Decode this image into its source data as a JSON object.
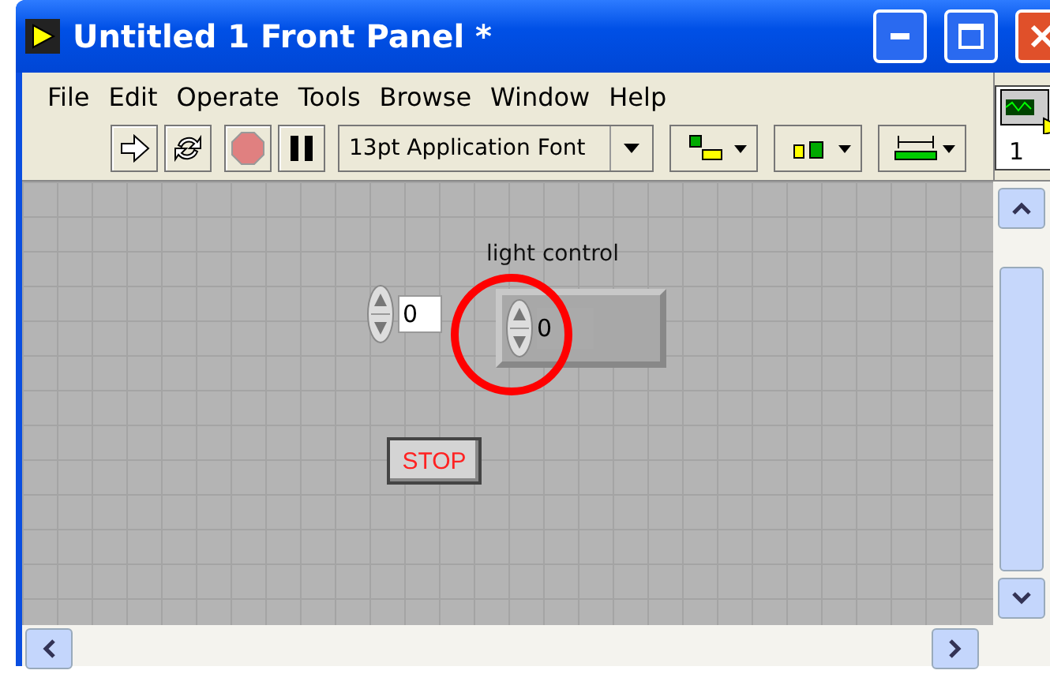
{
  "window": {
    "title": "Untitled 1 Front Panel *"
  },
  "menu": [
    "File",
    "Edit",
    "Operate",
    "Tools",
    "Browse",
    "Window",
    "Help"
  ],
  "toolbar": {
    "font": "13pt Application Font"
  },
  "connector_pane": {
    "number": "1"
  },
  "canvas": {
    "controls": [
      {
        "kind": "numeric",
        "value": "0"
      },
      {
        "kind": "framed-numeric",
        "label": "light control",
        "value": "0"
      },
      {
        "kind": "button",
        "label": "STOP"
      }
    ]
  }
}
